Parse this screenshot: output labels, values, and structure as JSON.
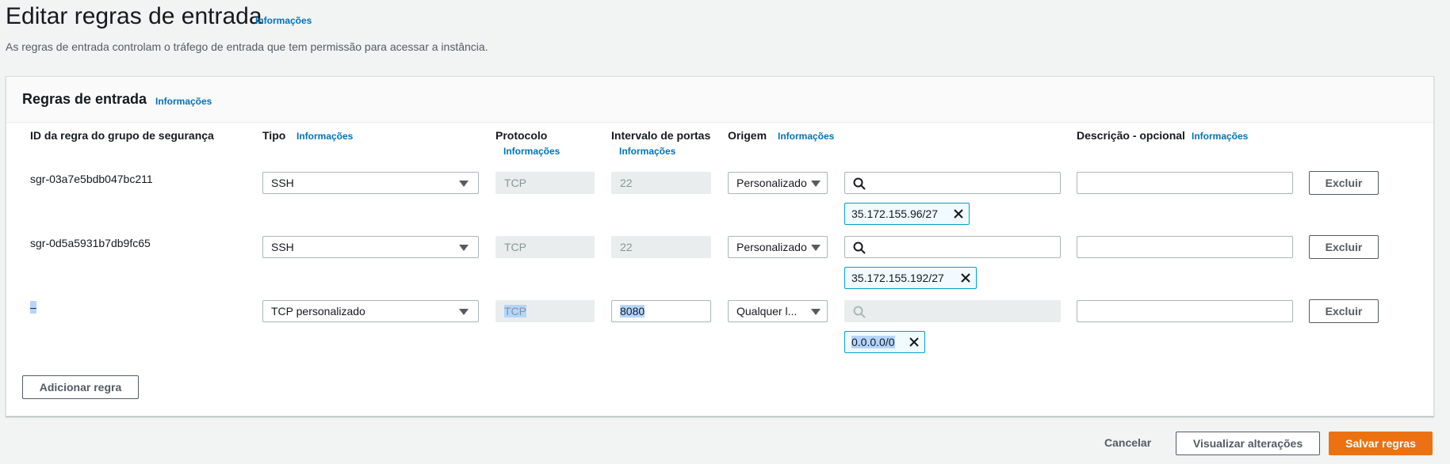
{
  "header": {
    "title": "Editar regras de entrada",
    "info": "Informações",
    "description": "As regras de entrada controlam o tráfego de entrada que tem permissão para acessar a instância."
  },
  "panel": {
    "title": "Regras de entrada",
    "info": "Informações"
  },
  "columns": {
    "rule_id": "ID da regra do grupo de segurança",
    "type": "Tipo",
    "type_info": "Informações",
    "protocol": "Protocolo",
    "protocol_info": "Informações",
    "port_range": "Intervalo de portas",
    "port_range_info": "Informações",
    "source": "Origem",
    "source_info": "Informações",
    "description": "Descrição - opcional",
    "description_info": "Informações"
  },
  "rules": [
    {
      "id": "sgr-03a7e5bdb047bc211",
      "type": "SSH",
      "protocol": "TCP",
      "port_range": "22",
      "source": "Personalizado",
      "search_value": "",
      "token": "35.172.155.96/27",
      "description": "",
      "delete_label": "Excluir"
    },
    {
      "id": "sgr-0d5a5931b7db9fc65",
      "type": "SSH",
      "protocol": "TCP",
      "port_range": "22",
      "source": "Personalizado",
      "search_value": "",
      "token": "35.172.155.192/27",
      "description": "",
      "delete_label": "Excluir"
    },
    {
      "id": "–",
      "type": "TCP personalizado",
      "protocol": "TCP",
      "port_range": "8080",
      "source": "Qualquer l...",
      "search_value": "",
      "token": "0.0.0.0/0",
      "description": "",
      "delete_label": "Excluir"
    }
  ],
  "add_rule_label": "Adicionar regra",
  "footer": {
    "cancel": "Cancelar",
    "preview": "Visualizar alterações",
    "save": "Salvar regras"
  },
  "icons": {
    "search": "search-icon",
    "dropdown": "caret-down-icon",
    "remove": "close-icon"
  },
  "colors": {
    "link": "#0073bb",
    "primary": "#ec7211",
    "token_border": "#00a1c9",
    "selection": "#b4d5fe"
  }
}
